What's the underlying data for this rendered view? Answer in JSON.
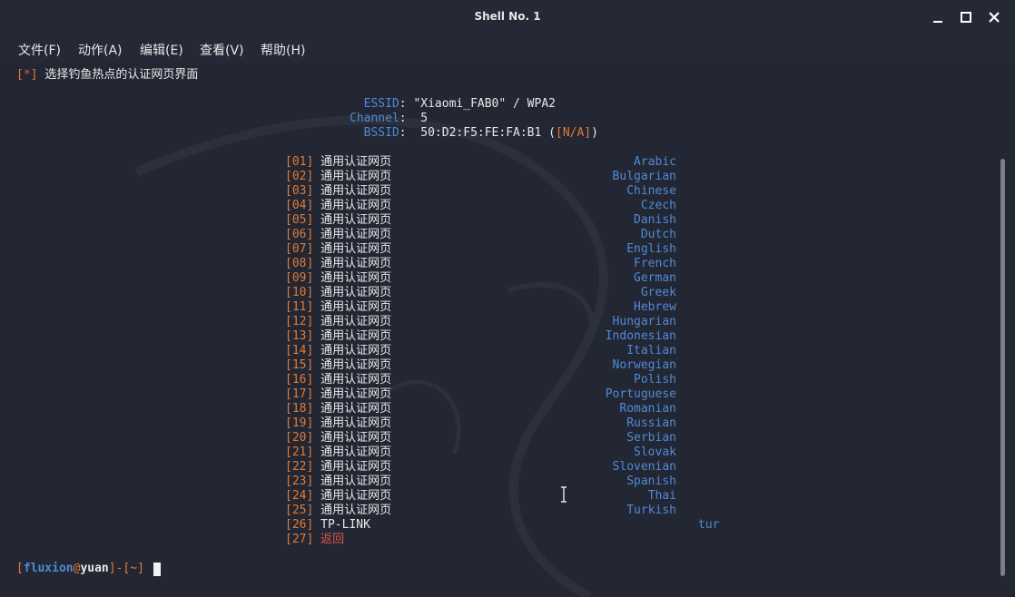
{
  "window": {
    "title": "Shell No. 1"
  },
  "menu": [
    "文件(F)",
    "动作(A)",
    "编辑(E)",
    "查看(V)",
    "帮助(H)"
  ],
  "header": {
    "prefix_open": "[",
    "prefix_mark": "*",
    "prefix_close": "]",
    "text": "选择钓鱼热点的认证网页界面"
  },
  "network": {
    "essid_label": "ESSID",
    "essid_value": "\"Xiaomi_FAB0\" / WPA2",
    "channel_label": "Channel",
    "channel_value": "5",
    "bssid_label": "BSSID",
    "bssid_value": "50:D2:F5:FE:FA:B1",
    "bssid_vendor": "[N/A]"
  },
  "options": [
    {
      "num": "01",
      "name": "通用认证网页",
      "lang": "Arabic"
    },
    {
      "num": "02",
      "name": "通用认证网页",
      "lang": "Bulgarian"
    },
    {
      "num": "03",
      "name": "通用认证网页",
      "lang": "Chinese"
    },
    {
      "num": "04",
      "name": "通用认证网页",
      "lang": "Czech"
    },
    {
      "num": "05",
      "name": "通用认证网页",
      "lang": "Danish"
    },
    {
      "num": "06",
      "name": "通用认证网页",
      "lang": "Dutch"
    },
    {
      "num": "07",
      "name": "通用认证网页",
      "lang": "English"
    },
    {
      "num": "08",
      "name": "通用认证网页",
      "lang": "French"
    },
    {
      "num": "09",
      "name": "通用认证网页",
      "lang": "German"
    },
    {
      "num": "10",
      "name": "通用认证网页",
      "lang": "Greek"
    },
    {
      "num": "11",
      "name": "通用认证网页",
      "lang": "Hebrew"
    },
    {
      "num": "12",
      "name": "通用认证网页",
      "lang": "Hungarian"
    },
    {
      "num": "13",
      "name": "通用认证网页",
      "lang": "Indonesian"
    },
    {
      "num": "14",
      "name": "通用认证网页",
      "lang": "Italian"
    },
    {
      "num": "15",
      "name": "通用认证网页",
      "lang": "Norwegian"
    },
    {
      "num": "16",
      "name": "通用认证网页",
      "lang": "Polish"
    },
    {
      "num": "17",
      "name": "通用认证网页",
      "lang": "Portuguese"
    },
    {
      "num": "18",
      "name": "通用认证网页",
      "lang": "Romanian"
    },
    {
      "num": "19",
      "name": "通用认证网页",
      "lang": "Russian"
    },
    {
      "num": "20",
      "name": "通用认证网页",
      "lang": "Serbian"
    },
    {
      "num": "21",
      "name": "通用认证网页",
      "lang": "Slovak"
    },
    {
      "num": "22",
      "name": "通用认证网页",
      "lang": "Slovenian"
    },
    {
      "num": "23",
      "name": "通用认证网页",
      "lang": "Spanish"
    },
    {
      "num": "24",
      "name": "通用认证网页",
      "lang": "Thai"
    },
    {
      "num": "25",
      "name": "通用认证网页",
      "lang": "Turkish"
    }
  ],
  "option_26": {
    "num": "26",
    "name": "TP-LINK",
    "lang": "tur"
  },
  "option_27": {
    "num": "27",
    "name": "返回"
  },
  "prompt": {
    "user": "fluxion",
    "at": "@",
    "host": "yuan",
    "dir": "~"
  },
  "colors": {
    "background": "#232733",
    "bracket_orange": "#e07b39",
    "accent_red": "#e2564b",
    "language_blue": "#4f8ad6"
  }
}
